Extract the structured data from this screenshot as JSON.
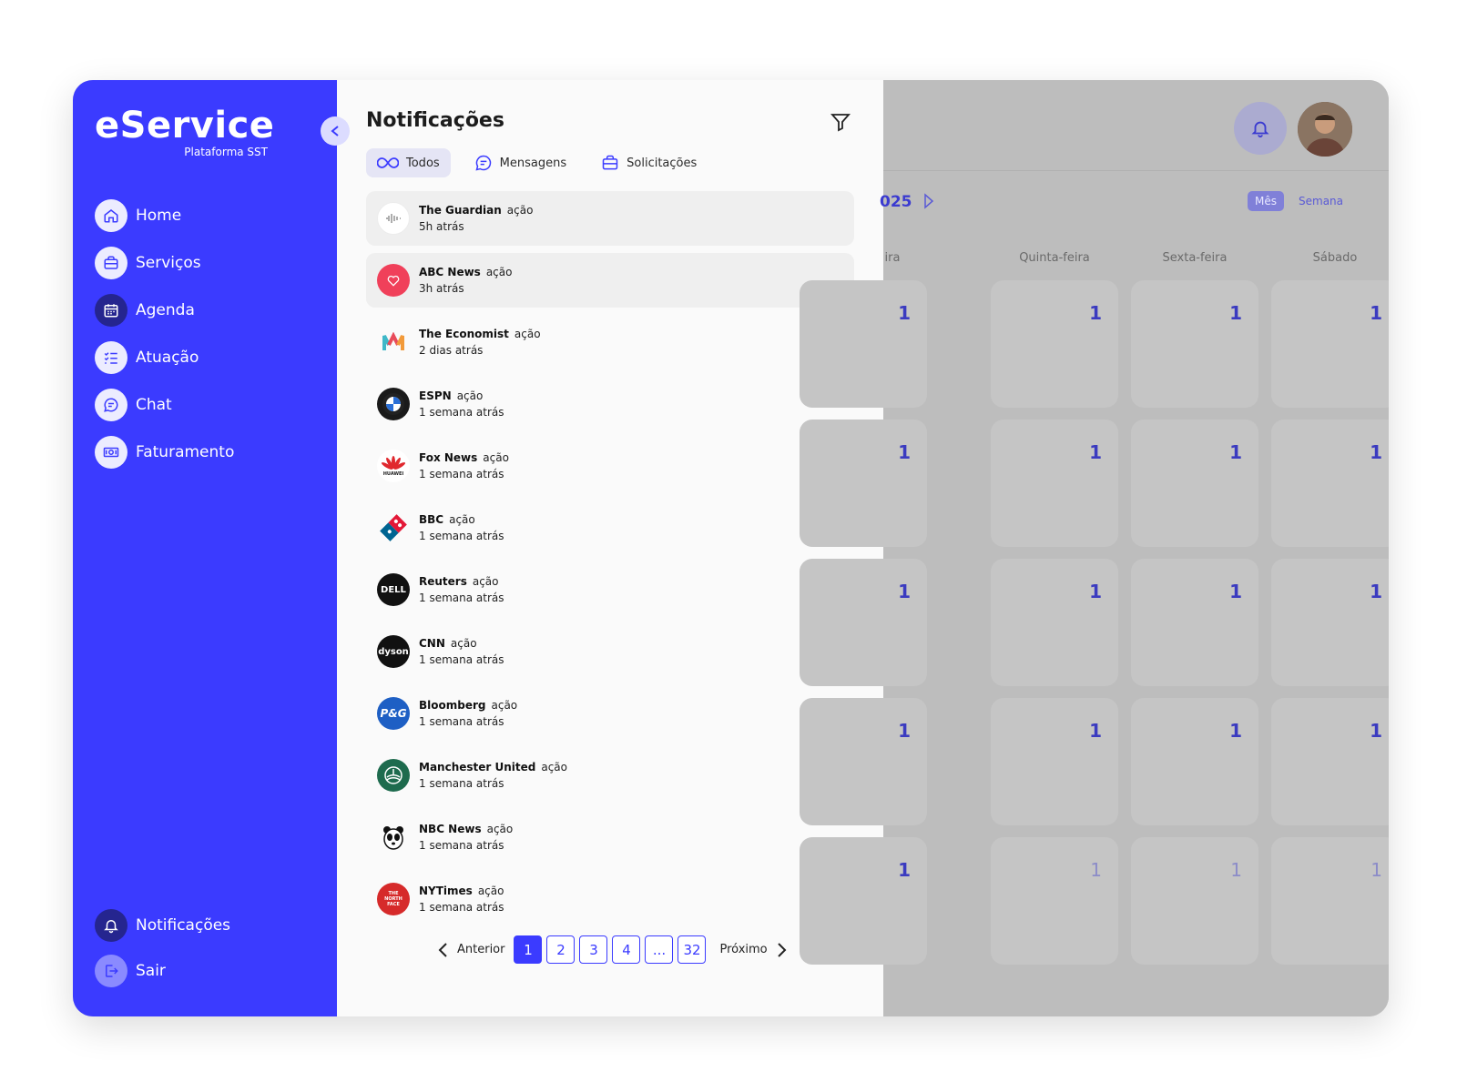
{
  "brand": {
    "name": "eService",
    "subtitle": "Plataforma SST"
  },
  "sidebar": {
    "items": [
      {
        "label": "Home",
        "icon": "home-icon"
      },
      {
        "label": "Serviços",
        "icon": "briefcase-icon"
      },
      {
        "label": "Agenda",
        "icon": "calendar-icon"
      },
      {
        "label": "Atuação",
        "icon": "checklist-icon"
      },
      {
        "label": "Chat",
        "icon": "chat-icon"
      },
      {
        "label": "Faturamento",
        "icon": "money-icon"
      }
    ],
    "bottom": [
      {
        "label": "Notificações",
        "icon": "bell-icon"
      },
      {
        "label": "Sair",
        "icon": "logout-icon"
      }
    ]
  },
  "panel": {
    "title": "Notificações",
    "tabs": [
      {
        "label": "Todos",
        "icon": "infinity-icon"
      },
      {
        "label": "Mensagens",
        "icon": "message-icon"
      },
      {
        "label": "Solicitações",
        "icon": "briefcase-icon"
      }
    ],
    "notifications": [
      {
        "name": "The Guardian",
        "action": "ação",
        "time": "5h atrás",
        "color": "#ffffff"
      },
      {
        "name": "ABC News",
        "action": "ação",
        "time": "3h atrás",
        "color": "#f0405a"
      },
      {
        "name": "The Economist",
        "action": "ação",
        "time": "2 dias atrás",
        "color": "#ffffff"
      },
      {
        "name": "ESPN",
        "action": "ação",
        "time": "1 semana atrás",
        "color": "#1a1a1a"
      },
      {
        "name": "Fox News",
        "action": "ação",
        "time": "1 semana atrás",
        "color": "#ffffff"
      },
      {
        "name": "BBC",
        "action": "ação",
        "time": "1 semana atrás",
        "color": "#ffffff"
      },
      {
        "name": "Reuters",
        "action": "ação",
        "time": "1 semana atrás",
        "color": "#111111"
      },
      {
        "name": "CNN",
        "action": "ação",
        "time": "1 semana atrás",
        "color": "#111111"
      },
      {
        "name": "Bloomberg",
        "action": "ação",
        "time": "1 semana atrás",
        "color": "#1e5fc4"
      },
      {
        "name": "Manchester United",
        "action": "ação",
        "time": "1 semana atrás",
        "color": "#1e6b4e"
      },
      {
        "name": "NBC News",
        "action": "ação",
        "time": "1 semana atrás",
        "color": "#ffffff"
      },
      {
        "name": "NYTimes",
        "action": "ação",
        "time": "1 semana atrás",
        "color": "#d62a2a"
      }
    ],
    "logo_text": {
      "dell": "DELL",
      "dyson": "dyson",
      "pg": "P&G",
      "tnf": "THE NORTH FACE",
      "huawei": "HUAWEI"
    },
    "pagination": {
      "prev": "Anterior",
      "next": "Próximo",
      "pages": [
        "1",
        "2",
        "3",
        "4",
        "...",
        "32"
      ],
      "current": "1"
    }
  },
  "calendar": {
    "year_fragment": "025",
    "views": [
      "Mês",
      "Semana"
    ],
    "weekday_fragment": "ira",
    "weekdays": [
      "Quinta-feira",
      "Sexta-feira",
      "Sábado"
    ],
    "day_value": "1"
  },
  "colors": {
    "primary": "#3b3bff",
    "panel_bg": "#fafafa",
    "overlay": "#bdbdbd"
  }
}
